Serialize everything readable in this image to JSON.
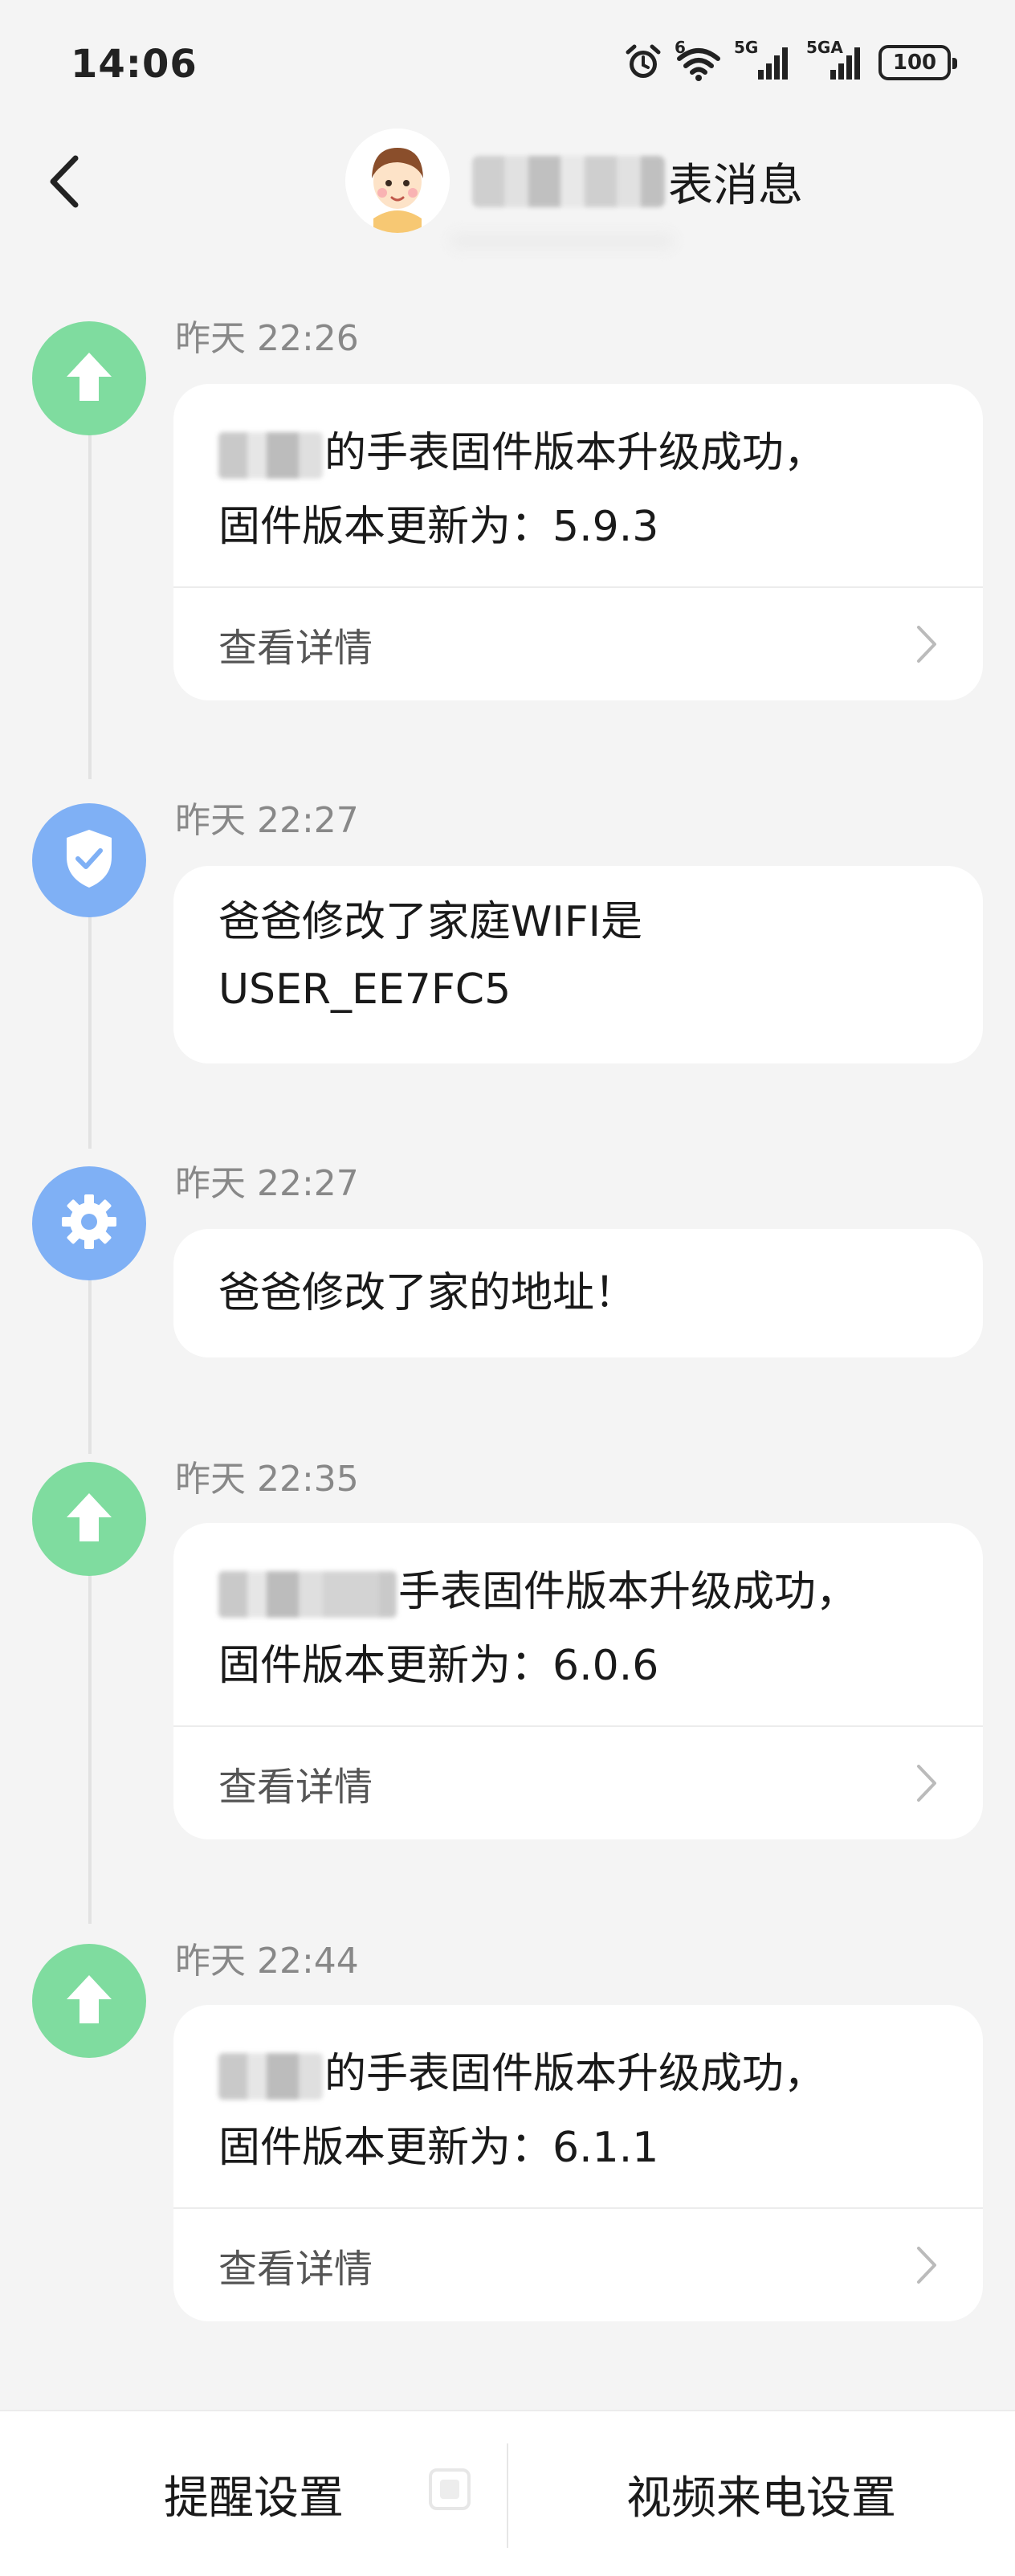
{
  "status_bar": {
    "time": "14:06",
    "wifi_tag": "6",
    "signal1_tag": "5G",
    "signal2_tag": "5GA",
    "battery": "100",
    "icons": [
      "alarm-icon",
      "wifi-icon",
      "signal-5g-icon",
      "signal-5ga-icon",
      "battery-icon"
    ]
  },
  "header": {
    "title_suffix": "表消息",
    "back_icon": "chevron-left-icon"
  },
  "messages": [
    {
      "time": "昨天 22:26",
      "icon": "upload-arrow-icon",
      "color": "#7fdc9f",
      "line1_suffix": "的手表固件版本升级成功，",
      "line2": "固件版本更新为：5.9.3",
      "details_label": "查看详情"
    },
    {
      "time": "昨天 22:27",
      "icon": "shield-check-icon",
      "color": "#7fb0f5",
      "line1": "爸爸修改了家庭WIFI是",
      "line2": "USER_EE7FC5"
    },
    {
      "time": "昨天 22:27",
      "icon": "gear-icon",
      "color": "#7fb0f5",
      "line1": "爸爸修改了家的地址！"
    },
    {
      "time": "昨天 22:35",
      "icon": "upload-arrow-icon",
      "color": "#7fdc9f",
      "line1_suffix": "手表固件版本升级成功，",
      "line2": "固件版本更新为：6.0.6",
      "details_label": "查看详情"
    },
    {
      "time": "昨天 22:44",
      "icon": "upload-arrow-icon",
      "color": "#7fdc9f",
      "line1_suffix": "的手表固件版本升级成功，",
      "line2": "固件版本更新为：6.1.1",
      "details_label": "查看详情"
    }
  ],
  "bottom_bar": {
    "left_label": "提醒设置",
    "right_label": "视频来电设置"
  }
}
